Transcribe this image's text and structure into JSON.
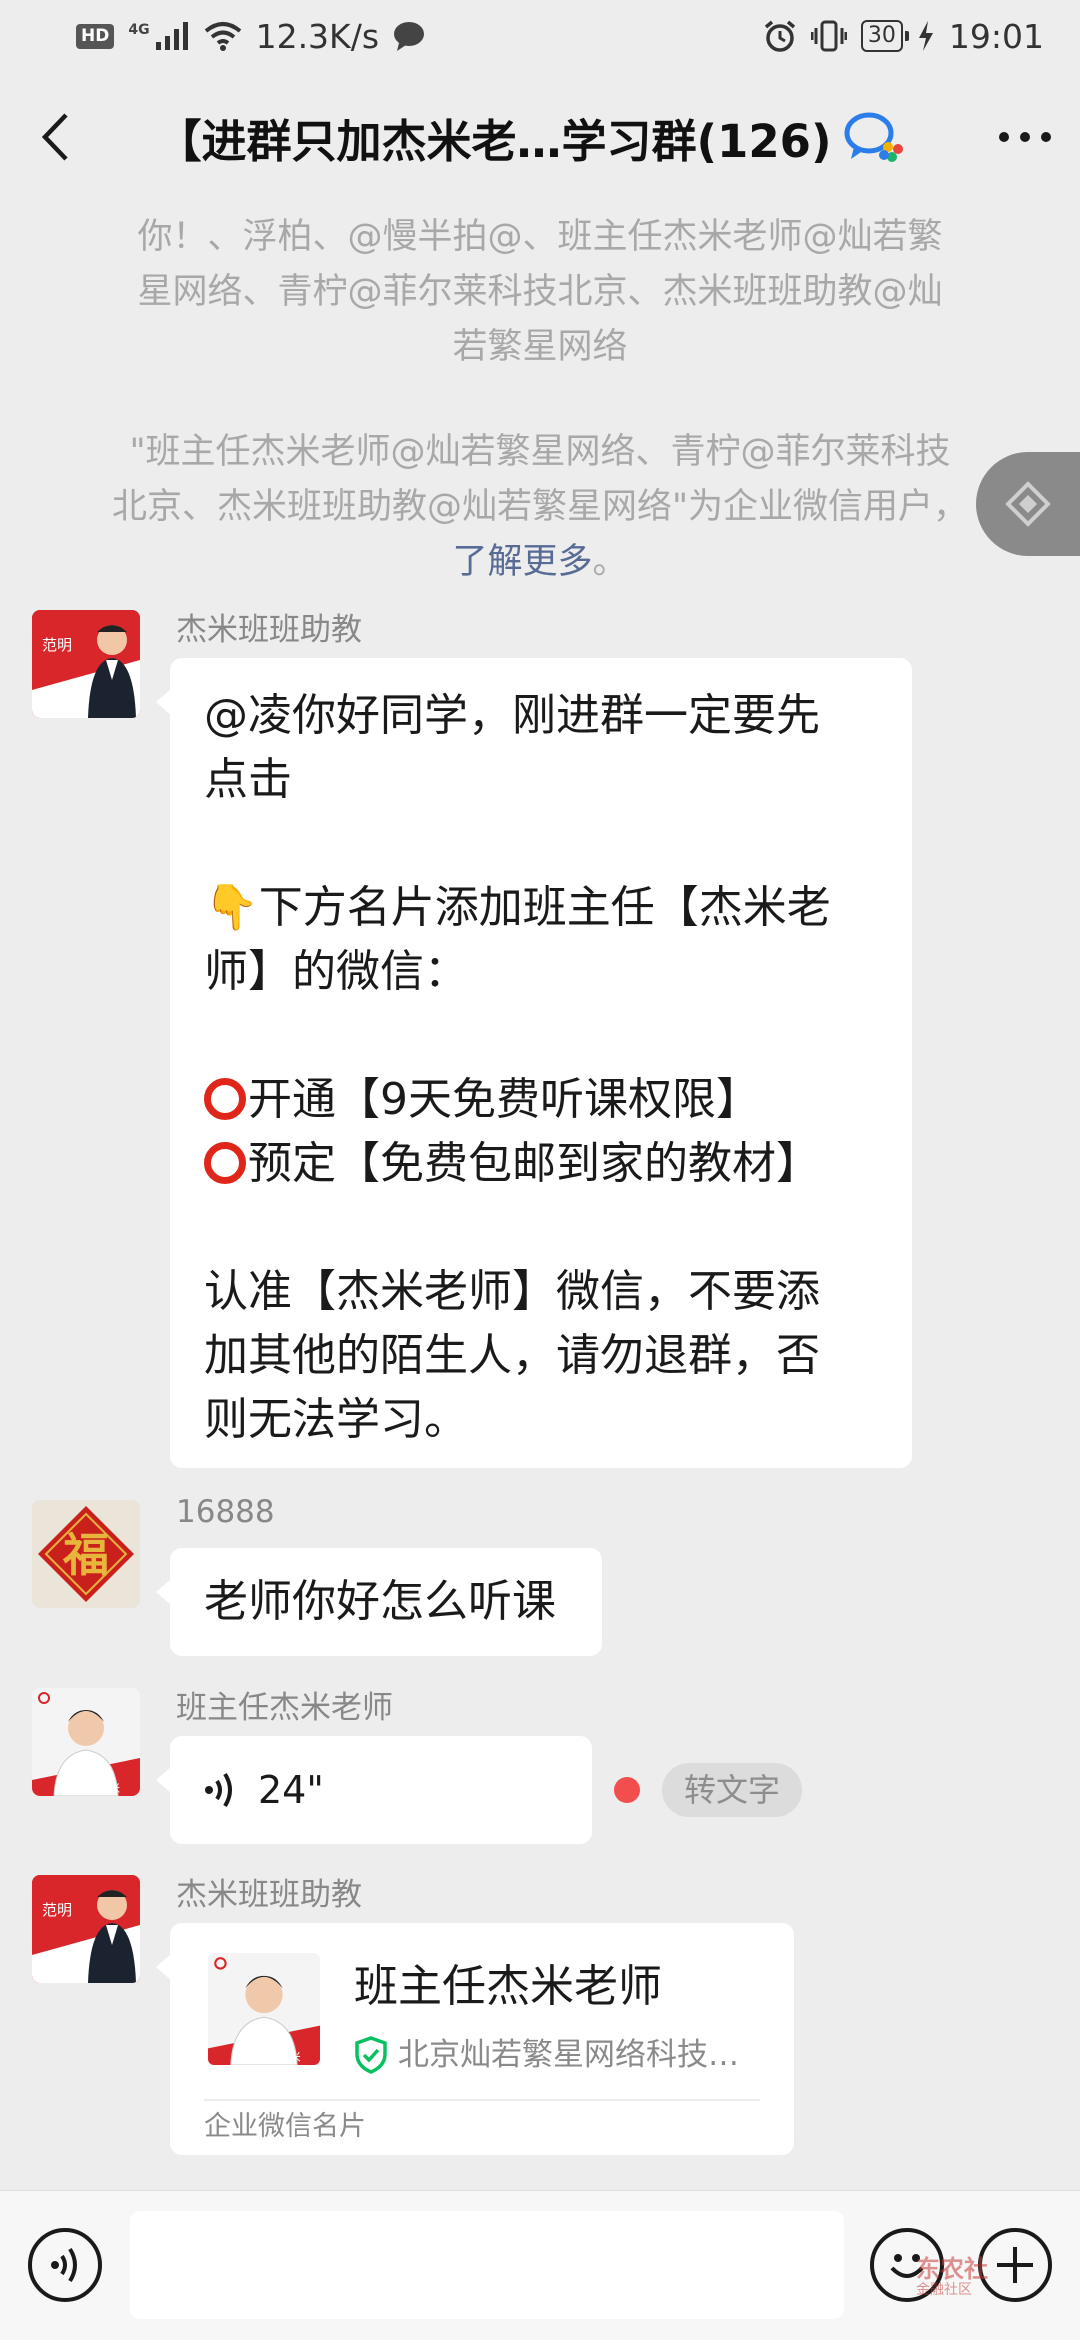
{
  "status_bar": {
    "hd": "HD",
    "network_type": "4G",
    "net_speed": "12.3K/s",
    "battery": "30",
    "time": "19:01"
  },
  "header": {
    "title": "【进群只加杰米老…学习群(126)"
  },
  "system_notice": {
    "line1": "你！、浮柏、@慢半拍@、班主任杰米老师@灿若繁",
    "line2": "星网络、青柠@菲尔莱科技北京、杰米班班助教@灿",
    "line3": "若繁星网络",
    "enterprise_line1": "\"班主任杰米老师@灿若繁星网络、青柠@菲尔莱科技",
    "enterprise_line2": "北京、杰米班班助教@灿若繁星网络\"为企业微信用户，",
    "learn_more": "了解更多",
    "period": "。"
  },
  "messages": [
    {
      "sender": "杰米班班助教",
      "avatar_label": "范明",
      "lines": [
        "@凌你好同学，刚进群一定要先",
        "点击",
        "",
        "👇下方名片添加班主任【杰米老",
        "师】的微信：",
        "",
        "开通【9天免费听课权限】",
        "预定【免费包邮到家的教材】",
        "",
        "认准【杰米老师】微信，不要添",
        "加其他的陌生人，请勿退群，否",
        "则无法学习。"
      ]
    },
    {
      "sender": "16888",
      "avatar_char": "福",
      "text": "老师你好怎么听课"
    },
    {
      "sender": "班主任杰米老师",
      "avatar_label": "杰米",
      "voice_duration": "24\"",
      "to_text_label": "转文字"
    },
    {
      "sender": "杰米班班助教",
      "avatar_label": "范明",
      "card": {
        "name": "班主任杰米老师",
        "company": "北京灿若繁星网络科技…",
        "photo_label": "杰 米",
        "footer": "企业微信名片"
      }
    }
  ],
  "input_bar": {
    "placeholder": ""
  },
  "watermark": {
    "line1": "东农社",
    "line2": "金融社区"
  },
  "colors": {
    "background": "#ededed",
    "bubble": "#ffffff",
    "link": "#576b95",
    "brand_red": "#d9262a",
    "verified_green": "#07c160"
  }
}
